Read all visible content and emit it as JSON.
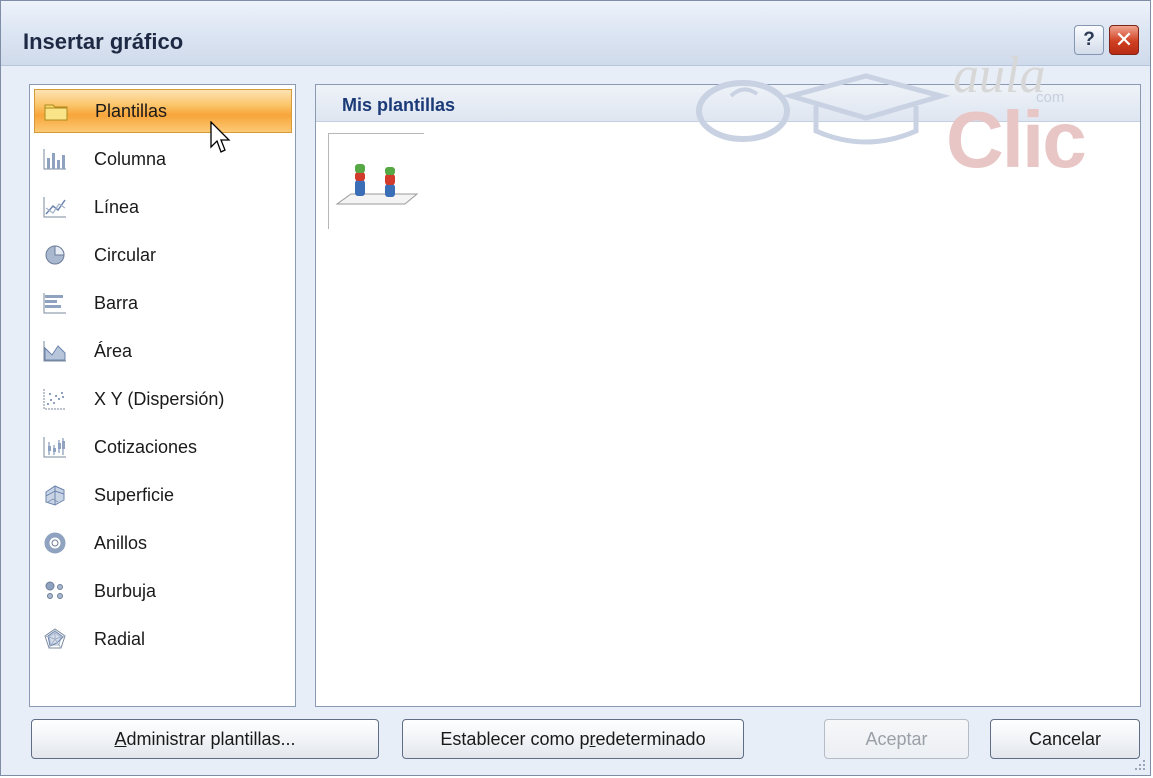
{
  "window": {
    "title": "Insertar gráfico",
    "help_label": "?",
    "close_label": "✕"
  },
  "watermark": {
    "aula": "aula",
    "clic": "Clic",
    "com": "com"
  },
  "categories": [
    {
      "label": "Plantillas",
      "icon": "folder-icon",
      "selected": true
    },
    {
      "label": "Columna",
      "icon": "column-chart-icon"
    },
    {
      "label": "Línea",
      "icon": "line-chart-icon"
    },
    {
      "label": "Circular",
      "icon": "pie-chart-icon"
    },
    {
      "label": "Barra",
      "icon": "bar-chart-icon"
    },
    {
      "label": "Área",
      "icon": "area-chart-icon"
    },
    {
      "label": "X Y (Dispersión)",
      "icon": "scatter-chart-icon"
    },
    {
      "label": "Cotizaciones",
      "icon": "stock-chart-icon"
    },
    {
      "label": "Superficie",
      "icon": "surface-chart-icon"
    },
    {
      "label": "Anillos",
      "icon": "doughnut-chart-icon"
    },
    {
      "label": "Burbuja",
      "icon": "bubble-chart-icon"
    },
    {
      "label": "Radial",
      "icon": "radar-chart-icon"
    }
  ],
  "right_panel": {
    "header": "Mis plantillas",
    "templates": [
      {
        "icon": "chart-template-icon"
      }
    ]
  },
  "buttons": {
    "manage": {
      "label": "Administrar plantillas...",
      "accel": "A",
      "rest": "dministrar plantillas..."
    },
    "set_default": {
      "label": "Establecer como predeterminado",
      "pre": "Establecer como p",
      "accel": "r",
      "post": "edeterminado"
    },
    "ok": {
      "label": "Aceptar",
      "enabled": false
    },
    "cancel": {
      "label": "Cancelar"
    }
  },
  "colors": {
    "selection": "#f7a53a",
    "header_text": "#1b3a78",
    "close_button": "#cf3f22"
  }
}
